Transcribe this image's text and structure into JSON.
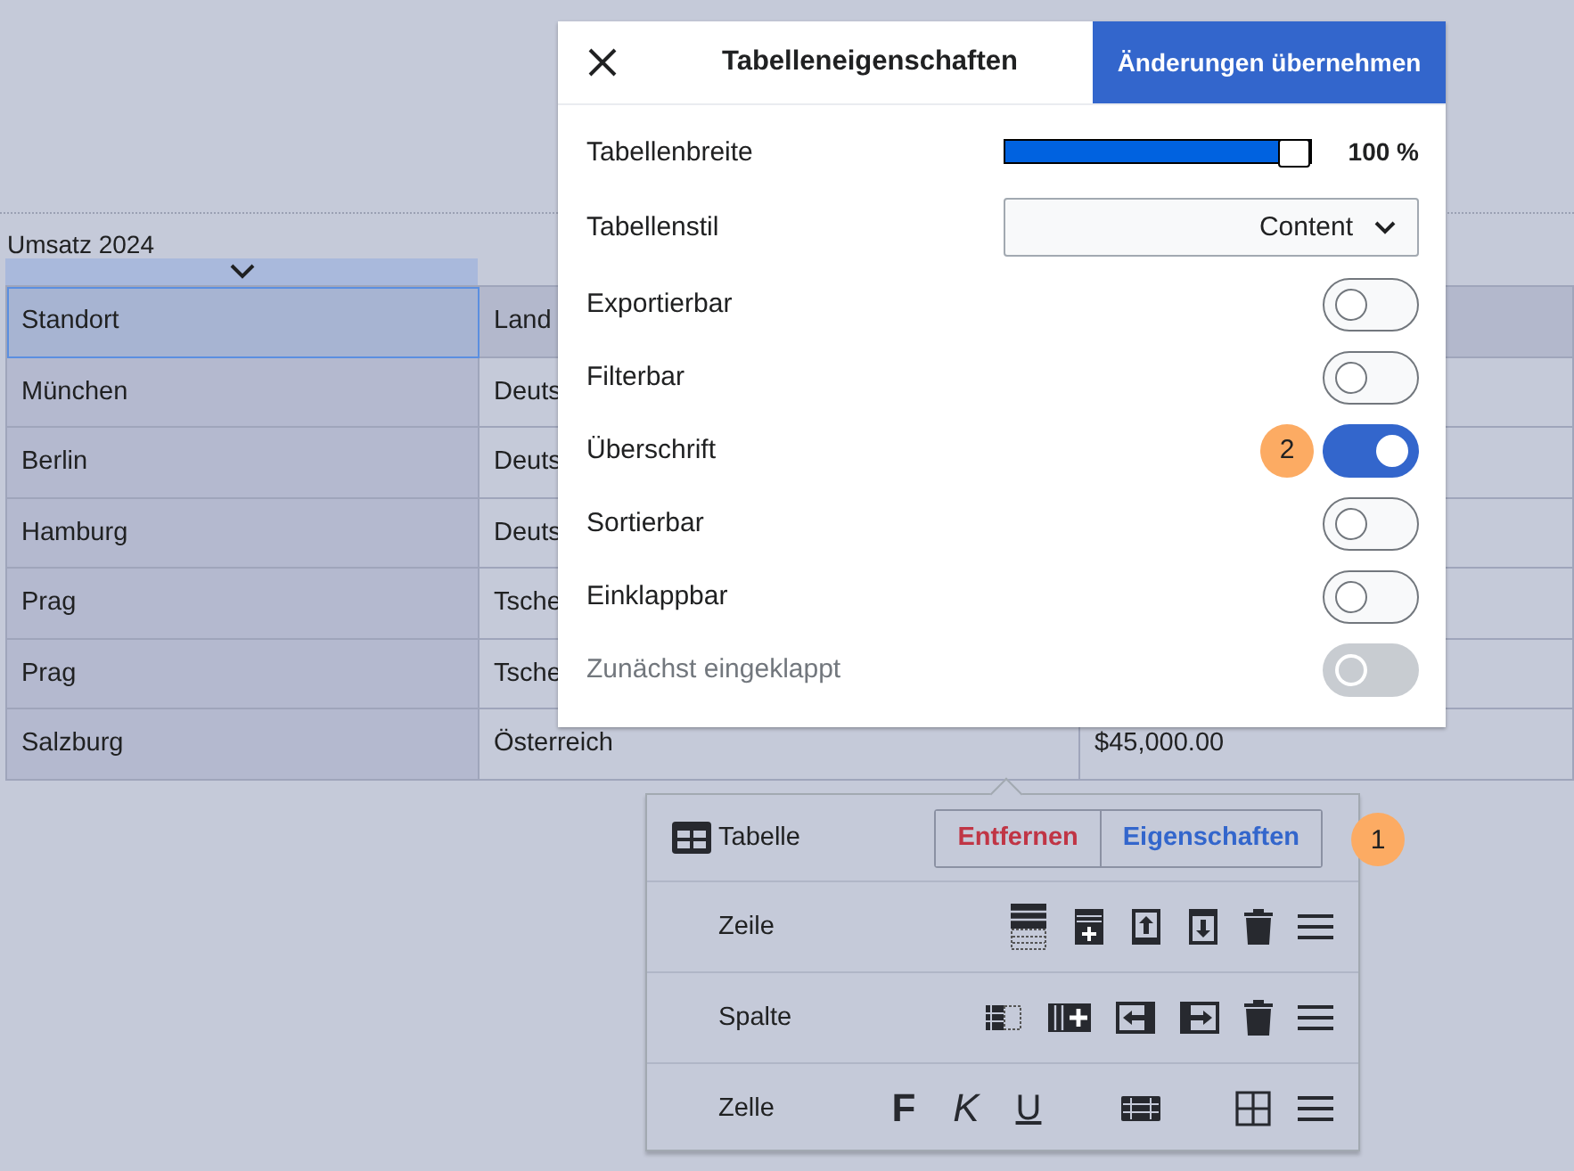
{
  "document": {
    "caption": "Umsatz 2024",
    "table": {
      "columns": [
        {
          "label": "Standort",
          "selected": true
        },
        {
          "label": "Land",
          "selected": false
        }
      ],
      "rows": [
        [
          "München",
          "Deuts"
        ],
        [
          "Berlin",
          "Deuts"
        ],
        [
          "Hamburg",
          "Deuts"
        ],
        [
          "Prag",
          "Tsche"
        ],
        [
          "Prag",
          "Tsche"
        ],
        [
          "Salzburg",
          "Österreich",
          "$45,000.00"
        ]
      ]
    }
  },
  "dialog": {
    "title": "Tabelleneigenschaften",
    "apply_button": "Änderungen übernehmen",
    "width": {
      "label": "Tabellenbreite",
      "level": 1,
      "reading": "100 %"
    },
    "style": {
      "label": "Tabellenstil",
      "value": "Content"
    },
    "options": [
      {
        "label": "Exportierbar",
        "on": false,
        "disabled": false
      },
      {
        "label": "Filterbar",
        "on": false,
        "disabled": false
      },
      {
        "label": "Überschrift",
        "on": true,
        "disabled": false,
        "badge": "2"
      },
      {
        "label": "Sortierbar",
        "on": false,
        "disabled": false
      },
      {
        "label": "Einklappbar",
        "on": false,
        "disabled": false
      },
      {
        "label": "Zunächst eingeklappt",
        "on": false,
        "disabled": true
      }
    ]
  },
  "toolbar": {
    "label": "Tabelle",
    "buttons": [
      {
        "label": "Entfernen",
        "kind": "danger"
      },
      {
        "label": "Eigenschaften",
        "kind": "primary"
      }
    ],
    "badge": "1",
    "rows": [
      {
        "label": "Zeile",
        "kind": "row"
      },
      {
        "label": "Spalte",
        "kind": "column"
      },
      {
        "label": "Zelle",
        "kind": "cell",
        "format_keys": [
          "F",
          "K",
          "U"
        ]
      }
    ]
  }
}
